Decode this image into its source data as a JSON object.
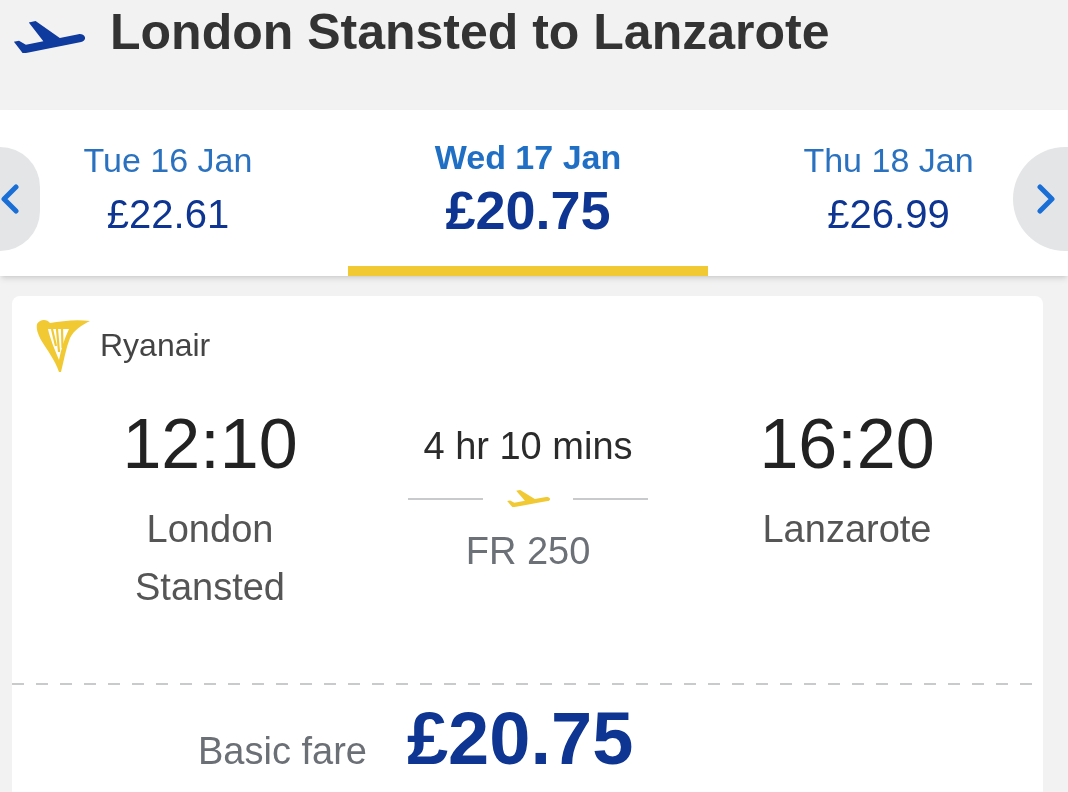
{
  "header": {
    "title": "London Stansted to Lanzarote"
  },
  "date_selector": {
    "dates": [
      {
        "day": "Tue 16 Jan",
        "price": "£22.61",
        "selected": false
      },
      {
        "day": "Wed 17 Jan",
        "price": "£20.75",
        "selected": true
      },
      {
        "day": "Thu 18 Jan",
        "price": "£26.99",
        "selected": false
      }
    ]
  },
  "flight_card": {
    "airline": "Ryanair",
    "departure": {
      "time": "12:10",
      "airport": "London Stansted"
    },
    "duration": "4 hr 10 mins",
    "flight_number": "FR 250",
    "arrival": {
      "time": "16:20",
      "airport": "Lanzarote"
    },
    "fare": {
      "label": "Basic fare",
      "price": "£20.75"
    }
  }
}
